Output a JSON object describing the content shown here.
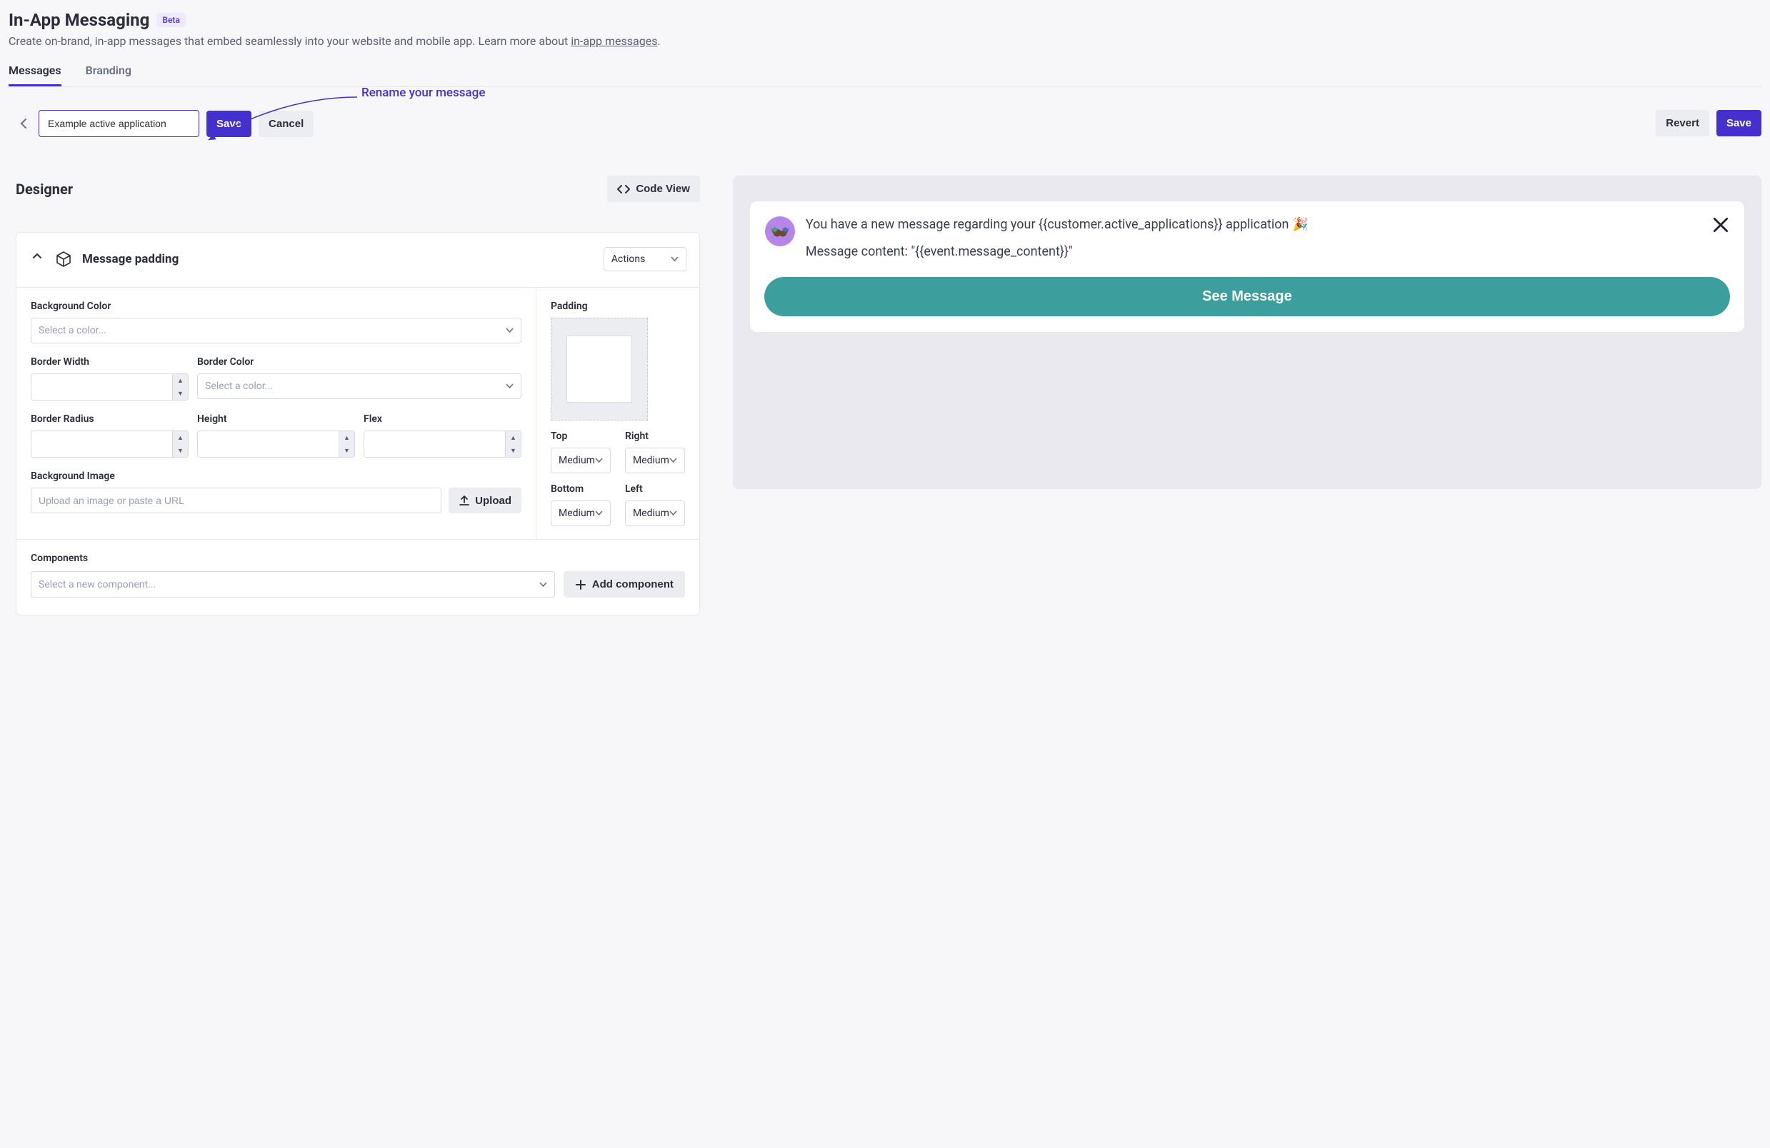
{
  "header": {
    "title": "In-App Messaging",
    "badge": "Beta",
    "subtitle_prefix": "Create on-brand, in-app messages that embed seamlessly into your website and mobile app. Learn more about ",
    "subtitle_link": "in-app messages",
    "subtitle_suffix": "."
  },
  "tabs": [
    {
      "label": "Messages",
      "active": true
    },
    {
      "label": "Branding",
      "active": false
    }
  ],
  "annotation": "Rename your message",
  "nameBar": {
    "value": "Example active application",
    "save": "Save",
    "cancel": "Cancel"
  },
  "topRight": {
    "revert": "Revert",
    "save": "Save"
  },
  "designer": {
    "title": "Designer",
    "codeView": "Code View",
    "panelTitle": "Message padding",
    "actions": "Actions",
    "left": {
      "bgColorLabel": "Background Color",
      "bgColorPlaceholder": "Select a color...",
      "borderWidthLabel": "Border Width",
      "borderColorLabel": "Border Color",
      "borderColorPlaceholder": "Select a color...",
      "borderRadiusLabel": "Border Radius",
      "heightLabel": "Height",
      "flexLabel": "Flex",
      "bgImageLabel": "Background Image",
      "bgImagePlaceholder": "Upload an image or paste a URL",
      "upload": "Upload"
    },
    "right": {
      "paddingLabel": "Padding",
      "topLabel": "Top",
      "rightLabel": "Right",
      "bottomLabel": "Bottom",
      "leftLabel": "Left",
      "topValue": "Medium",
      "rightValue": "Medium",
      "bottomValue": "Medium",
      "leftValue": "Medium"
    },
    "components": {
      "label": "Components",
      "placeholder": "Select a new component...",
      "addLabel": "Add component"
    }
  },
  "preview": {
    "line1": "You have a new message regarding your {{customer.active_applications}} application 🎉",
    "line2": "Message content: \"{{event.message_content}}\"",
    "button": "See Message"
  }
}
